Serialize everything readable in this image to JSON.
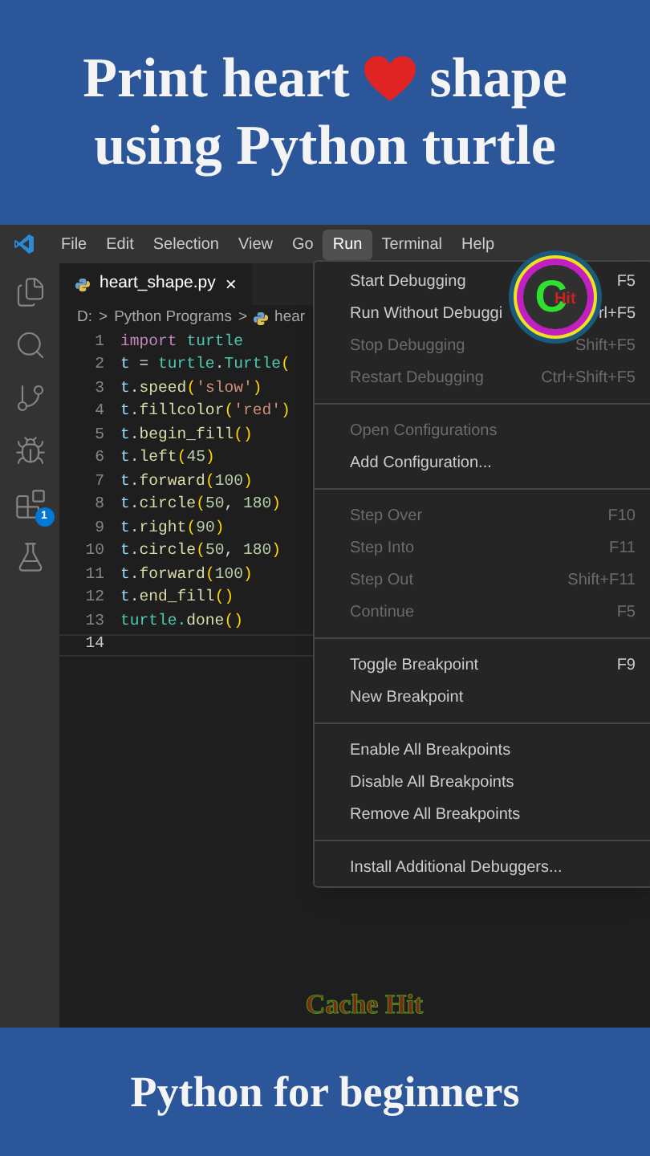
{
  "header": {
    "title_start": "Print heart",
    "title_end": "shape",
    "subtitle": "using Python turtle"
  },
  "menu_bar": [
    {
      "label": "File",
      "selected": false
    },
    {
      "label": "Edit",
      "selected": false
    },
    {
      "label": "Selection",
      "selected": false
    },
    {
      "label": "View",
      "selected": false
    },
    {
      "label": "Go",
      "selected": false
    },
    {
      "label": "Run",
      "selected": true
    },
    {
      "label": "Terminal",
      "selected": false
    },
    {
      "label": "Help",
      "selected": false
    }
  ],
  "activity_bar": {
    "extensions_badge": "1"
  },
  "tab": {
    "label": "heart_shape.py",
    "close": "×"
  },
  "breadcrumb": [
    "D:",
    "Python Programs",
    "hear"
  ],
  "breadcrumb_separator": ">",
  "code_lines": [
    {
      "number": "1",
      "current": false,
      "tokens": [
        {
          "kind": "keyword",
          "text": "import"
        },
        {
          "kind": "module",
          "text": "turtle",
          "space_before": true
        }
      ]
    },
    {
      "number": "2",
      "current": false,
      "tokens": [
        {
          "kind": "variable",
          "text": "t"
        },
        {
          "kind": "plain",
          "text": " = "
        },
        {
          "kind": "module",
          "text": "turtle"
        },
        {
          "kind": "plain",
          "text": "."
        },
        {
          "kind": "module",
          "text": "Turtle"
        },
        {
          "kind": "paren",
          "text": "("
        }
      ]
    },
    {
      "number": "3",
      "current": false,
      "tokens": [
        {
          "kind": "variable",
          "text": "t"
        },
        {
          "kind": "plain",
          "text": "."
        },
        {
          "kind": "function",
          "text": "speed"
        },
        {
          "kind": "paren",
          "text": "("
        },
        {
          "kind": "string",
          "text": "'slow'"
        },
        {
          "kind": "paren",
          "text": ")"
        }
      ]
    },
    {
      "number": "4",
      "current": false,
      "tokens": [
        {
          "kind": "variable",
          "text": "t"
        },
        {
          "kind": "plain",
          "text": "."
        },
        {
          "kind": "function",
          "text": "fillcolor"
        },
        {
          "kind": "paren",
          "text": "("
        },
        {
          "kind": "string",
          "text": "'red'"
        },
        {
          "kind": "paren",
          "text": ")"
        }
      ]
    },
    {
      "number": "5",
      "current": false,
      "tokens": [
        {
          "kind": "variable",
          "text": "t"
        },
        {
          "kind": "plain",
          "text": "."
        },
        {
          "kind": "function",
          "text": "begin_fill"
        },
        {
          "kind": "paren",
          "text": "()"
        }
      ]
    },
    {
      "number": "6",
      "current": false,
      "tokens": [
        {
          "kind": "variable",
          "text": "t"
        },
        {
          "kind": "plain",
          "text": "."
        },
        {
          "kind": "function",
          "text": "left"
        },
        {
          "kind": "paren",
          "text": "("
        },
        {
          "kind": "number",
          "text": "45"
        },
        {
          "kind": "paren",
          "text": ")"
        }
      ]
    },
    {
      "number": "7",
      "current": false,
      "tokens": [
        {
          "kind": "variable",
          "text": "t"
        },
        {
          "kind": "plain",
          "text": "."
        },
        {
          "kind": "function",
          "text": "forward"
        },
        {
          "kind": "paren",
          "text": "("
        },
        {
          "kind": "number",
          "text": "100"
        },
        {
          "kind": "paren",
          "text": ")"
        }
      ]
    },
    {
      "number": "8",
      "current": false,
      "tokens": [
        {
          "kind": "variable",
          "text": "t"
        },
        {
          "kind": "plain",
          "text": "."
        },
        {
          "kind": "function",
          "text": "circle"
        },
        {
          "kind": "paren",
          "text": "("
        },
        {
          "kind": "number",
          "text": "50"
        },
        {
          "kind": "plain",
          "text": ", "
        },
        {
          "kind": "number",
          "text": "180"
        },
        {
          "kind": "paren",
          "text": ")"
        }
      ]
    },
    {
      "number": "9",
      "current": false,
      "tokens": [
        {
          "kind": "variable",
          "text": "t"
        },
        {
          "kind": "plain",
          "text": "."
        },
        {
          "kind": "function",
          "text": "right"
        },
        {
          "kind": "paren",
          "text": "("
        },
        {
          "kind": "number",
          "text": "90"
        },
        {
          "kind": "paren",
          "text": ")"
        }
      ]
    },
    {
      "number": "10",
      "current": false,
      "tokens": [
        {
          "kind": "variable",
          "text": "t"
        },
        {
          "kind": "plain",
          "text": "."
        },
        {
          "kind": "function",
          "text": "circle"
        },
        {
          "kind": "paren",
          "text": "("
        },
        {
          "kind": "number",
          "text": "50"
        },
        {
          "kind": "plain",
          "text": ", "
        },
        {
          "kind": "number",
          "text": "180"
        },
        {
          "kind": "paren",
          "text": ")"
        }
      ]
    },
    {
      "number": "11",
      "current": false,
      "tokens": [
        {
          "kind": "variable",
          "text": "t"
        },
        {
          "kind": "plain",
          "text": "."
        },
        {
          "kind": "function",
          "text": "forward"
        },
        {
          "kind": "paren",
          "text": "("
        },
        {
          "kind": "number",
          "text": "100"
        },
        {
          "kind": "paren",
          "text": ")"
        }
      ]
    },
    {
      "number": "12",
      "current": false,
      "tokens": [
        {
          "kind": "variable",
          "text": "t"
        },
        {
          "kind": "plain",
          "text": "."
        },
        {
          "kind": "function",
          "text": "end_fill"
        },
        {
          "kind": "paren",
          "text": "()"
        }
      ]
    },
    {
      "number": "13",
      "current": false,
      "tokens": [
        {
          "kind": "module",
          "text": "turtle."
        },
        {
          "kind": "function",
          "text": "done"
        },
        {
          "kind": "paren",
          "text": "()"
        }
      ]
    },
    {
      "number": "14",
      "current": true
    }
  ],
  "run_menu": [
    {
      "kind": "item",
      "label": "Start Debugging",
      "shortcut": "F5",
      "disabled": false
    },
    {
      "kind": "item",
      "label": "Run Without Debuggi",
      "shortcut": "rl+F5",
      "disabled": false
    },
    {
      "kind": "item",
      "label": "Stop Debugging",
      "shortcut": "Shift+F5",
      "disabled": true
    },
    {
      "kind": "item",
      "label": "Restart Debugging",
      "shortcut": "Ctrl+Shift+F5",
      "disabled": true
    },
    {
      "kind": "separator"
    },
    {
      "kind": "item",
      "label": "Open Configurations",
      "disabled": true
    },
    {
      "kind": "item",
      "label": "Add Configuration...",
      "disabled": false
    },
    {
      "kind": "separator"
    },
    {
      "kind": "item",
      "label": "Step Over",
      "shortcut": "F10",
      "disabled": true
    },
    {
      "kind": "item",
      "label": "Step Into",
      "shortcut": "F11",
      "disabled": true
    },
    {
      "kind": "item",
      "label": "Step Out",
      "shortcut": "Shift+F11",
      "disabled": true
    },
    {
      "kind": "item",
      "label": "Continue",
      "shortcut": "F5",
      "disabled": true
    },
    {
      "kind": "separator"
    },
    {
      "kind": "item",
      "label": "Toggle Breakpoint",
      "shortcut": "F9",
      "disabled": false
    },
    {
      "kind": "item",
      "label": "New Breakpoint",
      "disabled": false
    },
    {
      "kind": "separator"
    },
    {
      "kind": "item",
      "label": "Enable All Breakpoints",
      "disabled": false
    },
    {
      "kind": "item",
      "label": "Disable All Breakpoints",
      "disabled": false
    },
    {
      "kind": "item",
      "label": "Remove All Breakpoints",
      "disabled": false
    },
    {
      "kind": "separator"
    },
    {
      "kind": "item",
      "label": "Install Additional Debuggers...",
      "disabled": false
    }
  ],
  "logo": {
    "letter": "C",
    "text": "Hit"
  },
  "channel_name": "Cache Hit",
  "footer": {
    "title": "Python for beginners"
  }
}
